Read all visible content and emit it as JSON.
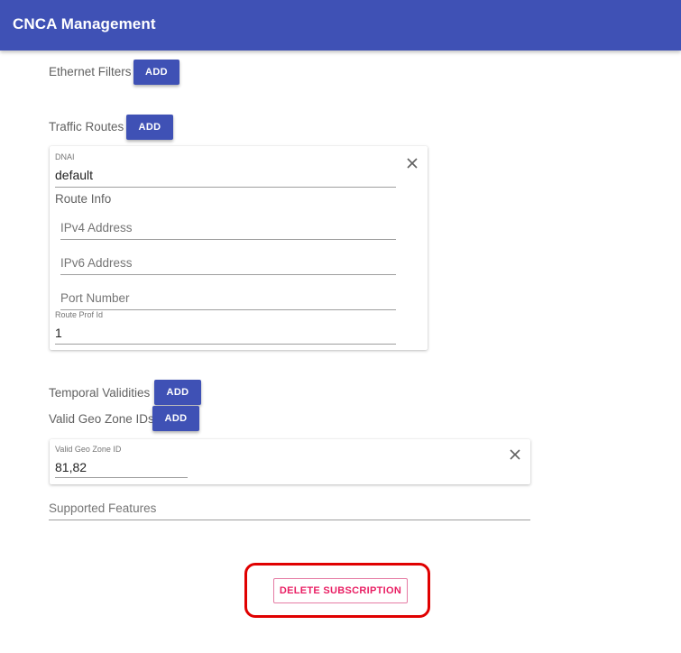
{
  "app": {
    "title": "CNCA Management"
  },
  "ethernet_filters": {
    "label": "Ethernet Filters",
    "add_label": "ADD"
  },
  "traffic_routes": {
    "label": "Traffic Routes",
    "add_label": "ADD",
    "route": {
      "dnai_label": "DNAI",
      "dnai_value": "default",
      "route_info_label": "Route Info",
      "ipv4_placeholder": "IPv4 Address",
      "ipv6_placeholder": "IPv6 Address",
      "port_placeholder": "Port Number",
      "route_prof_id_label": "Route Prof Id",
      "route_prof_id_value": "1",
      "remove_icon": "close-icon"
    }
  },
  "temporal_validities": {
    "label": "Temporal Validities",
    "add_label": "ADD"
  },
  "valid_geo_zone_ids": {
    "label": "Valid Geo Zone IDs",
    "add_label": "ADD",
    "item": {
      "field_label": "Valid Geo Zone ID",
      "field_value": "81,82",
      "remove_icon": "close-icon"
    }
  },
  "supported_features": {
    "placeholder": "Supported Features"
  },
  "delete_subscription": {
    "label": "DELETE SUBSCRIPTION"
  },
  "colors": {
    "primary": "#3f51b5",
    "accent": "#e91e63",
    "highlight": "#e00000"
  }
}
